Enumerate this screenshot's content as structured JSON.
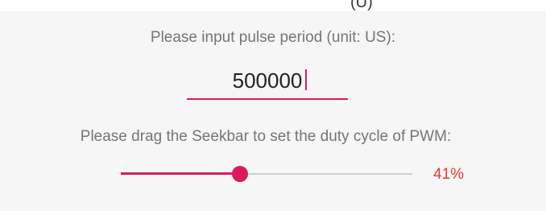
{
  "top_clipped_text": "(U)",
  "period": {
    "label": "Please input pulse period (unit: US):",
    "value": "500000"
  },
  "duty": {
    "label": "Please drag the Seekbar to set the duty cycle of PWM:",
    "percent_text": "41%",
    "fraction": 0.41
  },
  "colors": {
    "accent": "#d81b60",
    "value_text": "#e53935",
    "track": "#d0d0d0"
  }
}
